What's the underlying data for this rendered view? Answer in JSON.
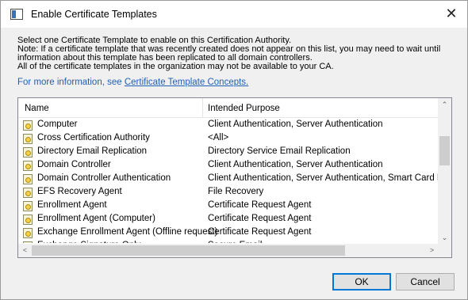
{
  "window": {
    "title": "Enable Certificate Templates",
    "close_glyph": "✕"
  },
  "description": {
    "lines": [
      "Select one Certificate Template to enable on this Certification Authority.",
      "Note: If a certificate template that was recently created does not appear on this list, you may need to wait until",
      "information about this template has been replicated to all domain controllers.",
      "All of the certificate templates in the organization may not be available to your CA."
    ],
    "more_info_prefix": "For more information, see ",
    "more_info_link": "Certificate Template Concepts."
  },
  "list": {
    "columns": [
      "Name",
      "Intended Purpose"
    ],
    "rows": [
      {
        "name": "Computer",
        "purpose": "Client Authentication, Server Authentication"
      },
      {
        "name": "Cross Certification Authority",
        "purpose": "<All>"
      },
      {
        "name": "Directory Email Replication",
        "purpose": "Directory Service Email Replication"
      },
      {
        "name": "Domain Controller",
        "purpose": "Client Authentication, Server Authentication"
      },
      {
        "name": "Domain Controller Authentication",
        "purpose": "Client Authentication, Server Authentication, Smart Card Logo"
      },
      {
        "name": "EFS Recovery Agent",
        "purpose": "File Recovery"
      },
      {
        "name": "Enrollment Agent",
        "purpose": "Certificate Request Agent"
      },
      {
        "name": "Enrollment Agent (Computer)",
        "purpose": "Certificate Request Agent"
      },
      {
        "name": "Exchange Enrollment Agent (Offline request)",
        "purpose": "Certificate Request Agent"
      },
      {
        "name": "Exchange Signature Only",
        "purpose": "Secure Email"
      }
    ],
    "icon": "certificate-template-icon",
    "scroll": {
      "up": "⌃",
      "down": "⌄",
      "left": "<",
      "right": ">"
    }
  },
  "buttons": {
    "ok": "OK",
    "cancel": "Cancel"
  }
}
